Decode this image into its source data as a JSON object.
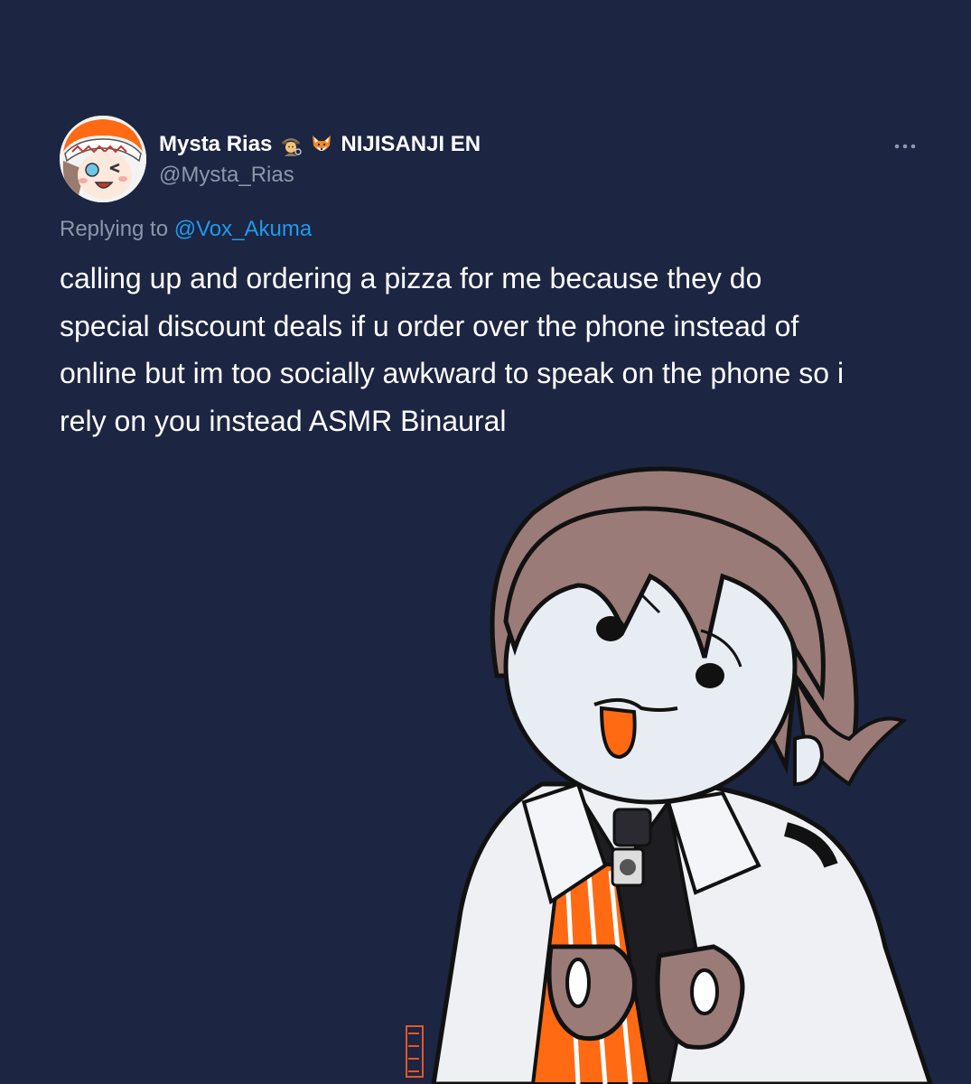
{
  "tweet": {
    "author": {
      "display_name": "Mysta Rias",
      "emoji_icons": [
        "detective-emoji",
        "fox-emoji"
      ],
      "affiliation": "NIJISANJI EN",
      "handle": "@Mysta_Rias"
    },
    "replying_prefix": "Replying to",
    "replying_to": "@Vox_Akuma",
    "text_lines": [
      "calling up and ordering a pizza for me because they do",
      "special discount deals if u order over the phone instead of",
      "online but im too socially awkward to speak on the phone so i",
      "rely on you instead ASMR Binaural"
    ],
    "more_icon": "more-horizontal-icon"
  },
  "colors": {
    "background": "#1c2541",
    "text": "#ffffff",
    "secondary_text": "#8b98a9",
    "link": "#1d9bf0",
    "accent_orange": "#ff6a13"
  },
  "illustration": {
    "subject": "chibi character drawing",
    "signature": "20 Lil Red 22"
  }
}
